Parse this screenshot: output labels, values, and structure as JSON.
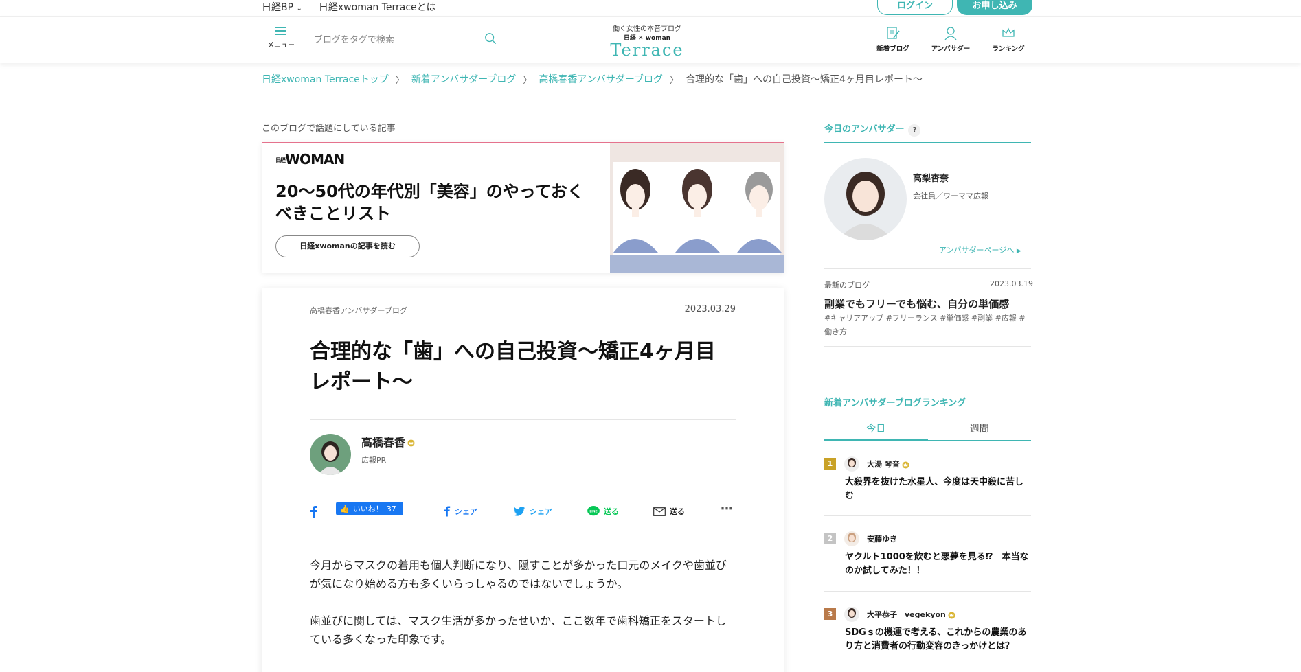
{
  "topbar": {
    "nikkeibp": "日経BP",
    "about": "日経xwoman Terraceとは",
    "login": "ログイン",
    "signup": "お申し込み"
  },
  "header": {
    "menu_label": "メニュー",
    "search_placeholder": "ブログをタグで検索",
    "logo_tagline": "働く女性の本音ブログ",
    "logo_sub": "日経 ✕ woman",
    "logo_name": "Terrace",
    "nav": {
      "new_blog": "新着ブログ",
      "ambassador": "アンバサダー",
      "ranking": "ランキング"
    }
  },
  "breadcrumb": {
    "top": "日経xwoman Terraceトップ",
    "new_blogs": "新着アンバサダーブログ",
    "author_blog": "高橋春香アンバサダーブログ",
    "current": "合理的な「歯」への自己投資〜矯正4ヶ月目レポート〜",
    "sep": "〉"
  },
  "feature": {
    "section_title": "このブログで話題にしている記事",
    "brand_small": "日経",
    "brand": "WOMAN",
    "headline": "20〜50代の年代別「美容」のやっておくべきことリスト",
    "read_button": "日経xwomanの記事を読む"
  },
  "article": {
    "blog_name": "高橋春香アンバサダーブログ",
    "date": "2023.03.29",
    "title": "合理的な「歯」への自己投資〜矯正4ヶ月目レポート〜",
    "author_name": "高橋春香",
    "author_role": "広報PR",
    "like_label": "いいね！",
    "like_count": "37",
    "share_facebook": "シェア",
    "share_twitter": "シェア",
    "share_line": "送る",
    "share_mail": "送る",
    "para1": "今月からマスクの着用も個人判断になり、隠すことが多かった口元のメイクや歯並びが気になり始める方も多くいらっしゃるのではないでしょうか。",
    "para2": "歯並びに関しては、マスク生活が多かったせいか、ここ数年で歯科矯正をスタートしている多くなった印象です。"
  },
  "sidebar": {
    "today_ambassador_title": "今日のアンバサダー",
    "help": "?",
    "ambassador_name": "高梨杏奈",
    "ambassador_role": "会社員／ワーママ広報",
    "ambassador_link": "アンバサダーページへ",
    "latest_label": "最新のブログ",
    "latest_date": "2023.03.19",
    "latest_title": "副業でもフリーでも悩む、自分の単価感",
    "latest_tags": "#キャリアアップ  #フリーランス  #単価感  #副業  #広報  #働き方",
    "ranking_title": "新着アンバサダーブログランキング",
    "tab_today": "今日",
    "tab_week": "週間",
    "ranking": [
      {
        "rank": "1",
        "name": "大湯 琴音",
        "title": "大殺界を抜けた水星人、今度は天中殺に苦しむ"
      },
      {
        "rank": "2",
        "name": "安藤ゆき",
        "title": "ヤクルト1000を飲むと悪夢を見る⁉　本当なのか試してみた！！"
      },
      {
        "rank": "3",
        "name": "大平恭子｜vegekyon",
        "title": "SDGｓの機運で考える、これからの農業のあり方と消費者の行動変容のきっかけとは？"
      }
    ]
  },
  "colors": {
    "accent": "#3fb6b3",
    "feature_border": "#e5728d",
    "facebook": "#1877f2",
    "gold": "#c9a227",
    "silver": "#c4c4c4",
    "bronze": "#b97a4a"
  }
}
